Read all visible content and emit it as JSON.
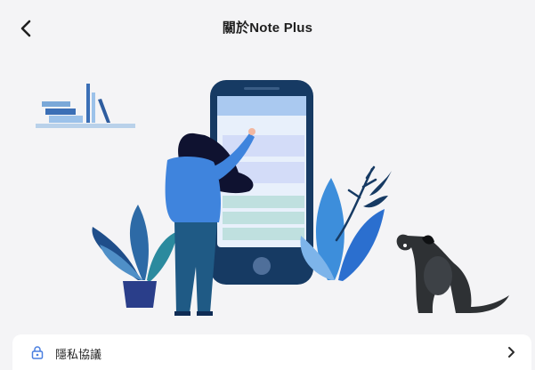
{
  "header": {
    "title": "關於Note Plus",
    "back_icon": "chevron-left-icon"
  },
  "illustration": {
    "subject": "woman-tapping-large-phone-illustration"
  },
  "settings_rows": [
    {
      "icon": "lock-icon",
      "label": "隱私協議",
      "chevron": "chevron-right-icon"
    }
  ],
  "colors": {
    "background": "#f4f4f6",
    "card": "#ffffff",
    "accent_blue": "#4a7fe0",
    "navy": "#163a63",
    "teal": "#2f6f8f"
  }
}
